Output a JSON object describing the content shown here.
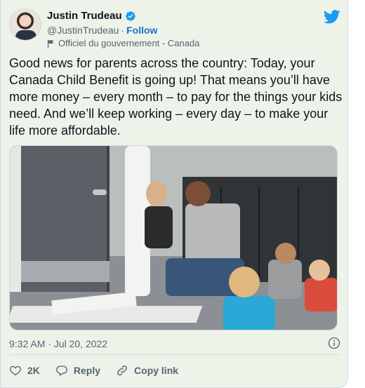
{
  "author": {
    "name": "Justin Trudeau",
    "handle": "@JustinTrudeau",
    "separator": "·",
    "follow_label": "Follow",
    "account_label": "Officiel du gouvernement - Canada",
    "verified_icon": "verified-badge-icon",
    "avatar": "profile-photo"
  },
  "tweet": {
    "text": "Good news for parents across the country: Today, your Canada Child Benefit is going up! That means you’ll have more money – every month – to pay for the things your kids need. And we’ll keep working – every day – to make your life more affordable.",
    "timestamp": "9:32 AM · Jul 20, 2022"
  },
  "media": {
    "type": "photo"
  },
  "actions": {
    "like_count": "2K",
    "reply_label": "Reply",
    "copy_link_label": "Copy link"
  },
  "colors": {
    "twitter_blue": "#1d9bf0",
    "like_red": "#f91880",
    "card_background": "#eef3ea"
  }
}
